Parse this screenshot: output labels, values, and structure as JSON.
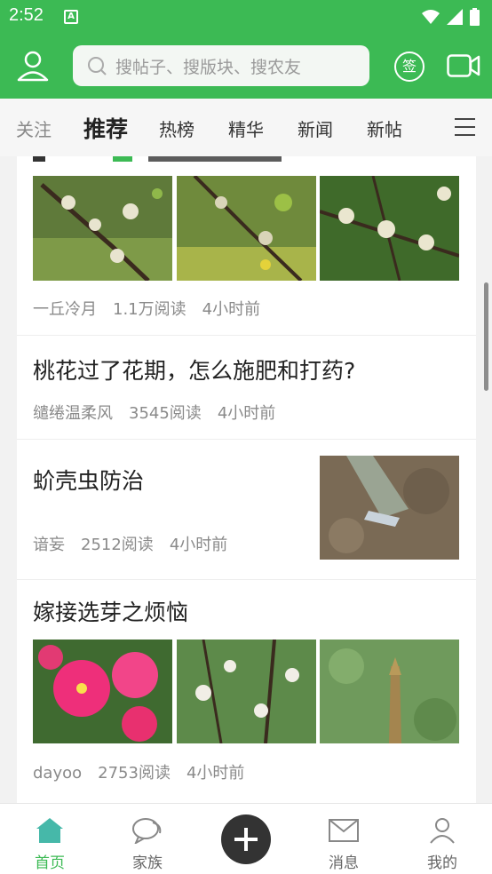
{
  "status": {
    "time": "2:52",
    "sim_label": "A"
  },
  "header": {
    "search_placeholder": "搜帖子、搜版块、搜农友",
    "sign_label": "签"
  },
  "tabs": [
    "关注",
    "推荐",
    "热榜",
    "精华",
    "新闻",
    "新帖"
  ],
  "active_tab": "推荐",
  "feed": {
    "posts": [
      {
        "author": "一丘冷月",
        "reads": "1.1万阅读",
        "time": "4小时前"
      },
      {
        "title": "桃花过了花期，怎么施肥和打药?",
        "author": "缱绻温柔风",
        "reads": "3545阅读",
        "time": "4小时前"
      },
      {
        "title": "蚧壳虫防治",
        "author": "谙妄",
        "reads": "2512阅读",
        "time": "4小时前"
      },
      {
        "title": "嫁接选芽之烦恼",
        "author": "dayoo",
        "reads": "2753阅读",
        "time": "4小时前"
      }
    ]
  },
  "bottom_nav": {
    "home": "首页",
    "family": "家族",
    "messages": "消息",
    "mine": "我的"
  },
  "colors": {
    "brand": "#3cba54",
    "fab": "#333333"
  },
  "icons": [
    "user-icon",
    "search-icon",
    "sign-icon",
    "video-camera-icon",
    "menu-icon",
    "home-icon",
    "chat-icon",
    "plus-icon",
    "mail-icon",
    "profile-icon"
  ]
}
